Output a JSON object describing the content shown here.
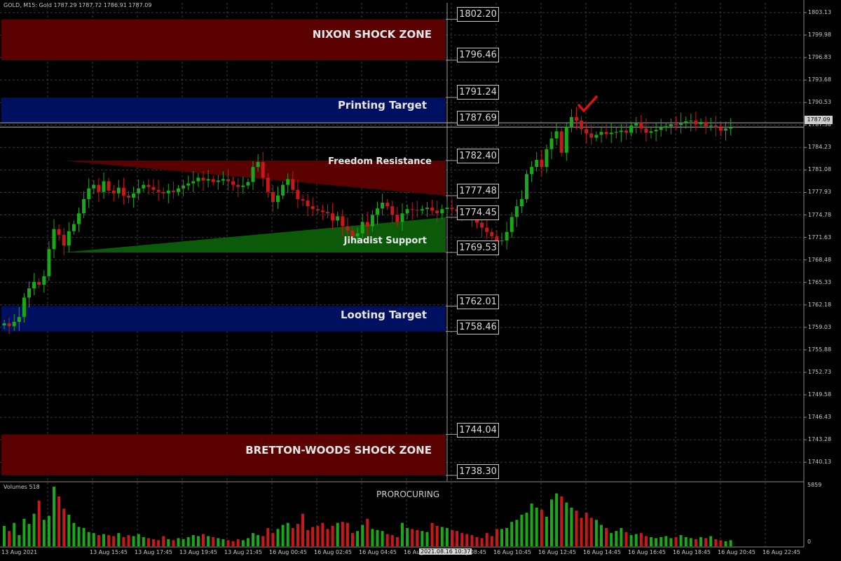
{
  "header": {
    "symbol_info": "GOLD, M15:  Gold  1787.29 1787.72 1786.91 1787.09"
  },
  "volume_panel": {
    "label": "Volumes 518",
    "max_label": "5859",
    "zero_label": "0",
    "annotation": "PROROCURING"
  },
  "zones": [
    {
      "label": "NIXON SHOCK ZONE",
      "top": 1802.2,
      "bottom": 1796.46,
      "color": "#5a0000"
    },
    {
      "label": "Printing Target",
      "top": 1791.24,
      "bottom": 1787.69,
      "color": "#001060"
    },
    {
      "label": "Looting Target",
      "top": 1762.01,
      "bottom": 1758.46,
      "color": "#001060"
    },
    {
      "label": "BRETTON-WOODS SHOCK ZONE",
      "top": 1744.04,
      "bottom": 1738.3,
      "color": "#5a0000"
    }
  ],
  "wedges": [
    {
      "label": "Freedom Resistance",
      "color": "#5a0000"
    },
    {
      "label": "Jihadist Support",
      "color": "#0a5a0a"
    }
  ],
  "levels": [
    "1802.20",
    "1796.46",
    "1791.24",
    "1787.69",
    "1782.40",
    "1777.48",
    "1774.45",
    "1769.53",
    "1762.01",
    "1758.46",
    "1744.04",
    "1738.30"
  ],
  "current_price_label": "1787.09",
  "current_time_label": "2021.08.16 10:37",
  "colors": {
    "bull": "#18a818",
    "bear": "#c81818",
    "grid": "#3a3a3a",
    "background": "#000000"
  },
  "chart_data": {
    "type": "candlestick",
    "title": "",
    "y_range": [
      1737.5,
      1804.5
    ],
    "y_ticks": [
      "1803.13",
      "1799.98",
      "1796.83",
      "1793.68",
      "1790.53",
      "1787.38",
      "1784.23",
      "1781.08",
      "1777.93",
      "1774.78",
      "1771.63",
      "1768.48",
      "1765.33",
      "1762.18",
      "1759.03",
      "1755.88",
      "1752.73",
      "1749.58",
      "1746.43",
      "1743.28",
      "1740.13"
    ],
    "x_ticks": [
      "13 Aug 2021",
      "13 Aug 15:45",
      "13 Aug 17:45",
      "13 Aug 19:45",
      "13 Aug 21:45",
      "16 Aug 00:45",
      "16 Aug 02:45",
      "16 Aug 04:45",
      "16 Aug 06:45",
      "16 Aug 08:45",
      "16 Aug 10:45",
      "16 Aug 12:45",
      "16 Aug 14:45",
      "16 Aug 16:45",
      "16 Aug 18:45",
      "16 Aug 20:45",
      "16 Aug 22:45"
    ],
    "close": [
      1759.6,
      1759.2,
      1759.8,
      1760.5,
      1763.2,
      1764.5,
      1765.4,
      1765.0,
      1766.2,
      1770.0,
      1772.8,
      1772.0,
      1770.5,
      1772.5,
      1773.5,
      1775.0,
      1777.0,
      1778.5,
      1779.0,
      1778.0,
      1779.5,
      1778.2,
      1777.8,
      1778.6,
      1777.5,
      1777.2,
      1777.8,
      1778.5,
      1779.0,
      1778.7,
      1778.3,
      1778.0,
      1777.8,
      1778.2,
      1778.0,
      1778.5,
      1778.9,
      1779.2,
      1779.5,
      1780.0,
      1779.6,
      1779.8,
      1779.4,
      1779.6,
      1779.8,
      1779.5,
      1779.0,
      1778.7,
      1778.9,
      1779.4,
      1781.5,
      1782.2,
      1780.0,
      1778.0,
      1776.6,
      1777.5,
      1779.0,
      1779.8,
      1778.3,
      1777.0,
      1776.8,
      1776.0,
      1775.6,
      1775.4,
      1775.2,
      1775.0,
      1774.0,
      1774.6,
      1773.2,
      1772.6,
      1771.8,
      1772.2,
      1773.8,
      1773.2,
      1774.8,
      1775.7,
      1776.5,
      1776.0,
      1774.8,
      1773.8,
      1775.0,
      1775.6,
      1775.5,
      1775.4,
      1775.6,
      1775.8,
      1775.4,
      1775.0,
      1775.6,
      1775.8,
      1775.6,
      1775.3,
      1775.0,
      1774.7,
      1774.3,
      1773.7,
      1773.0,
      1772.4,
      1771.8,
      1771.2,
      1771.2,
      1772.4,
      1774.5,
      1776.0,
      1777.0,
      1780.5,
      1781.5,
      1782.5,
      1781.5,
      1784.0,
      1785.5,
      1786.5,
      1783.5,
      1787.0,
      1788.5,
      1788.0,
      1786.8,
      1786.2,
      1785.6,
      1786.0,
      1786.4,
      1786.1,
      1786.3,
      1786.4,
      1786.6,
      1786.3,
      1787.3,
      1787.7,
      1786.9,
      1786.3,
      1786.5,
      1786.7,
      1787.0,
      1787.2,
      1787.5,
      1787.4,
      1787.7,
      1787.9,
      1788.0,
      1787.5,
      1787.8,
      1787.2,
      1787.3,
      1787.0,
      1786.6,
      1786.9,
      1787.09
    ],
    "volumes": [
      2000,
      1500,
      2300,
      1100,
      2700,
      2200,
      3200,
      4500,
      2600,
      3000,
      5859,
      4900,
      3700,
      3100,
      2300,
      1900,
      1800,
      1400,
      1300,
      1100,
      1200,
      1100,
      1000,
      1300,
      900,
      1100,
      1000,
      1200,
      900,
      800,
      700,
      600,
      1000,
      700,
      600,
      800,
      700,
      900,
      1100,
      1000,
      1200,
      1000,
      900,
      800,
      700,
      600,
      500,
      700,
      600,
      800,
      1300,
      1100,
      1000,
      1800,
      1300,
      1700,
      2100,
      2300,
      1800,
      2200,
      3200,
      1600,
      1900,
      2000,
      2300,
      1700,
      2000,
      2300,
      2400,
      2300,
      1300,
      1500,
      2100,
      2700,
      1700,
      1600,
      1500,
      1200,
      1100,
      900,
      2300,
      1800,
      1700,
      1600,
      1500,
      1400,
      2300,
      2000,
      1900,
      1800,
      1600,
      1500,
      1300,
      1200,
      1100,
      900,
      800,
      1300,
      1000,
      1700,
      1700,
      1800,
      2400,
      2600,
      3100,
      3300,
      4200,
      3800,
      3600,
      2900,
      4600,
      5200,
      4900,
      4300,
      3800,
      3500,
      2800,
      3300,
      2800,
      2600,
      2100,
      1800,
      1300,
      1500,
      1800,
      1400,
      1100,
      1200,
      1300,
      1000,
      900,
      800,
      900,
      1000,
      800,
      900,
      1100,
      900,
      800,
      700,
      900,
      800,
      1000,
      700,
      600,
      500,
      600,
      700
    ]
  }
}
